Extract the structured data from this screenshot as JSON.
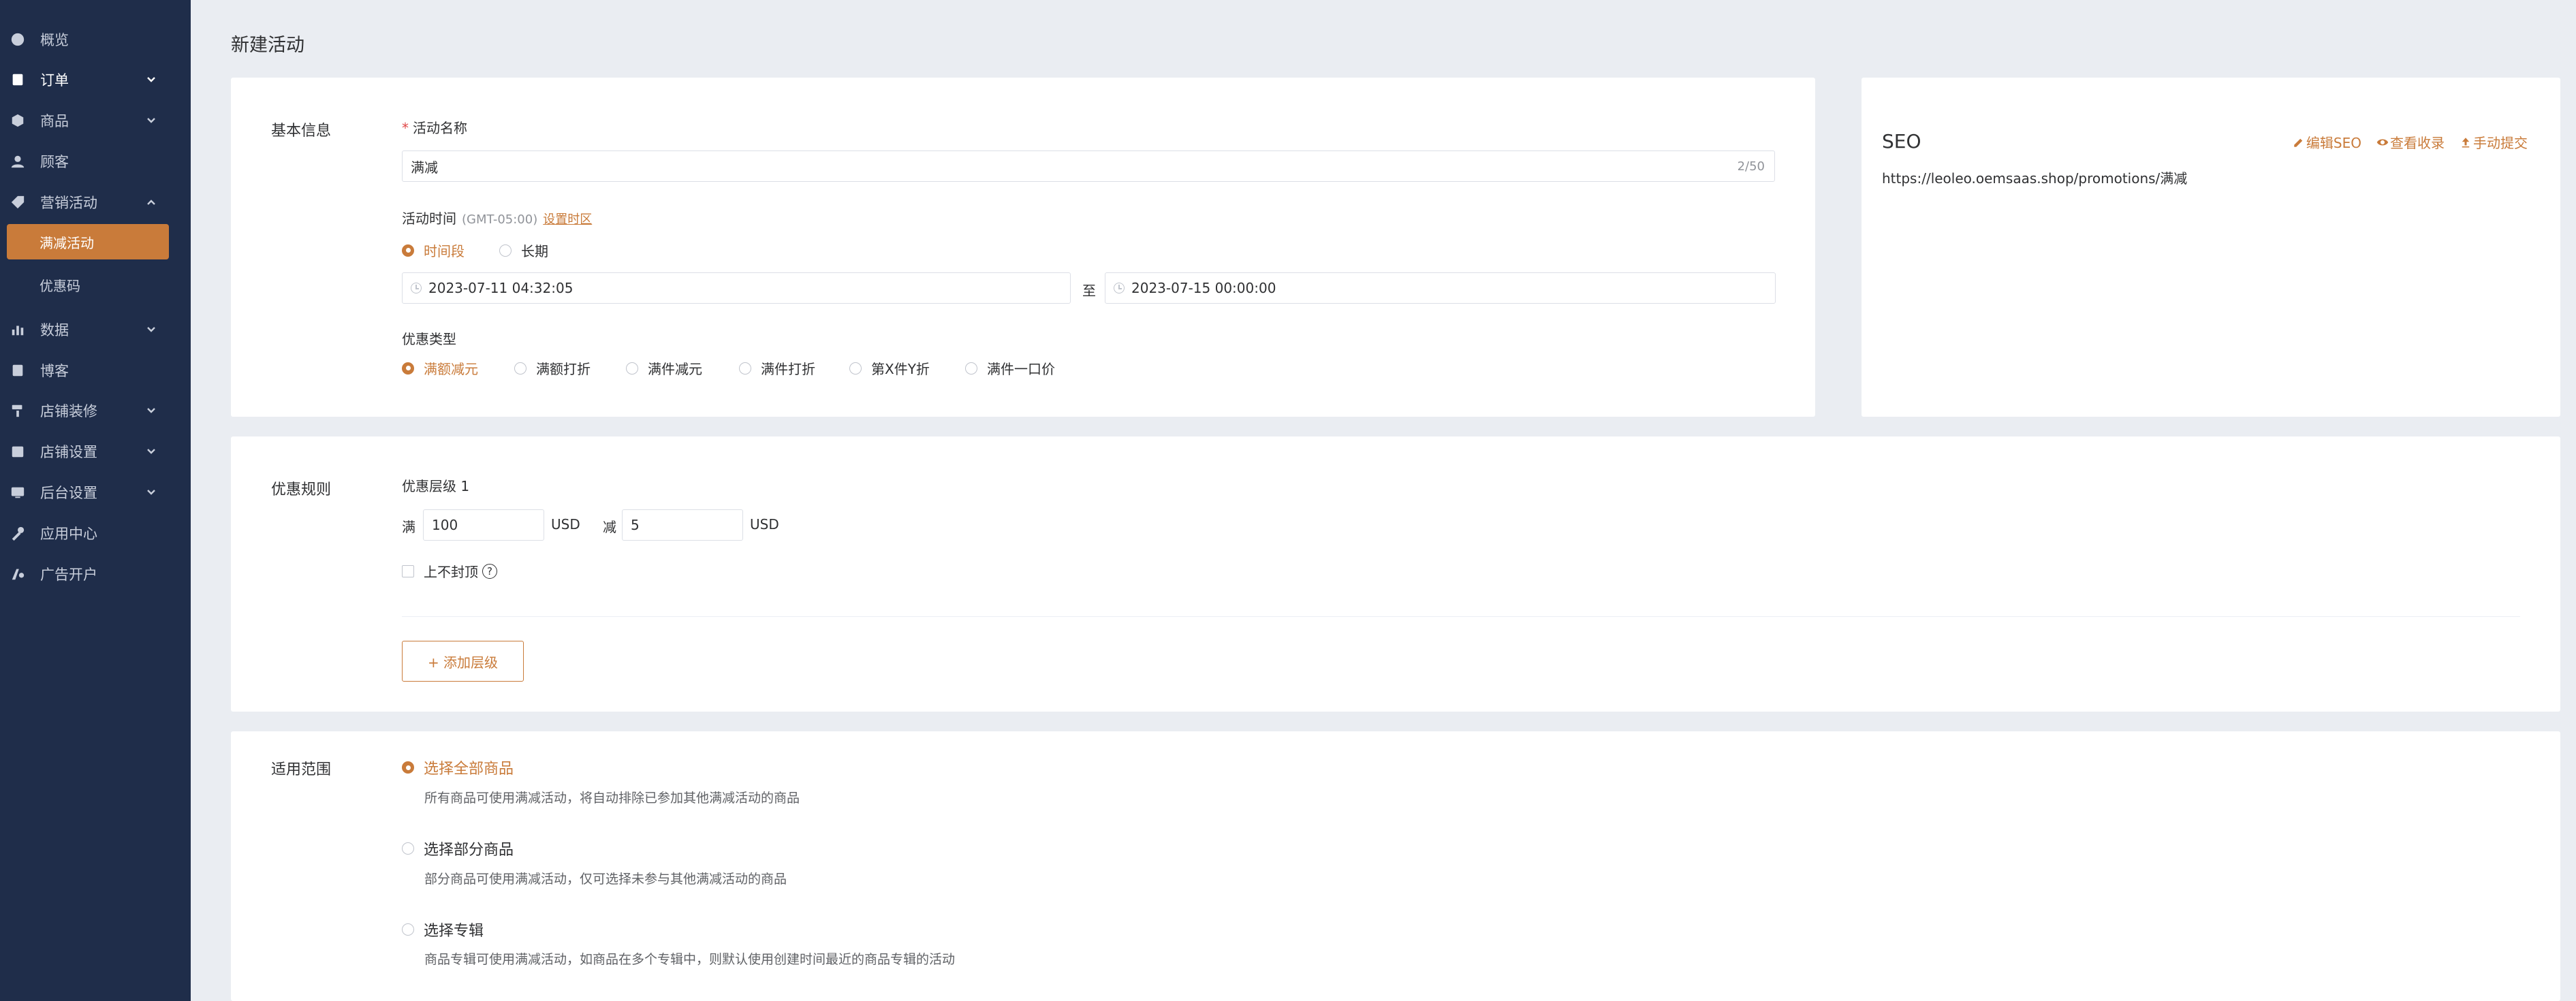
{
  "sidebar": {
    "items": [
      {
        "label": "概览",
        "icon": "dashboard-icon"
      },
      {
        "label": "订单",
        "icon": "order-icon"
      },
      {
        "label": "商品",
        "icon": "product-icon"
      },
      {
        "label": "顾客",
        "icon": "customer-icon"
      },
      {
        "label": "营销活动",
        "icon": "marketing-icon"
      },
      {
        "label": "数据",
        "icon": "data-icon"
      },
      {
        "label": "博客",
        "icon": "blog-icon"
      },
      {
        "label": "店铺装修",
        "icon": "decoration-icon"
      },
      {
        "label": "店铺设置",
        "icon": "store-settings-icon"
      },
      {
        "label": "后台设置",
        "icon": "admin-settings-icon"
      },
      {
        "label": "应用中心",
        "icon": "app-center-icon"
      },
      {
        "label": "广告开户",
        "icon": "ads-icon"
      }
    ],
    "marketing_sub": {
      "active": "满减活动",
      "coupon": "优惠码"
    }
  },
  "page": {
    "title": "新建活动"
  },
  "basic": {
    "section_label": "基本信息",
    "name_label": "活动名称",
    "name_required_mark": "*",
    "name_value": "满减",
    "name_counter": "2/50",
    "time_label": "活动时间",
    "time_zone": "(GMT-05:00)",
    "time_zone_link": "设置时区",
    "time_mode_period": "时间段",
    "time_mode_long": "长期",
    "start_time": "2023-07-11 04:32:05",
    "to_text": "至",
    "end_time": "2023-07-15 00:00:00",
    "discount_type_label": "优惠类型",
    "discount_types": [
      "满额减元",
      "满额打折",
      "满件减元",
      "满件打折",
      "第X件Y折",
      "满件一口价"
    ]
  },
  "seo": {
    "title": "SEO",
    "edit": "编辑SEO",
    "view": "查看收录",
    "submit": "手动提交",
    "url": "https://leoleo.oemsaas.shop/promotions/满减"
  },
  "rules": {
    "section_label": "优惠规则",
    "tier_label": "优惠层级 1",
    "full_text": "满",
    "threshold": "100",
    "currency1": "USD",
    "minus_text": "减",
    "amount": "5",
    "currency2": "USD",
    "no_cap_label": "上不封顶",
    "help_mark": "?",
    "add_tier": "+ 添加层级"
  },
  "scope": {
    "section_label": "适用范围",
    "options": [
      {
        "title": "选择全部商品",
        "desc": "所有商品可使用满减活动，将自动排除已参加其他满减活动的商品"
      },
      {
        "title": "选择部分商品",
        "desc": "部分商品可使用满减活动，仅可选择未参与其他满减活动的商品"
      },
      {
        "title": "选择专辑",
        "desc": "商品专辑可使用满减活动，如商品在多个专辑中，则默认使用创建时间最近的商品专辑的活动"
      }
    ]
  },
  "colors": {
    "accent": "#c97b3a",
    "sidebar": "#1f2d4a",
    "background": "#eaedf2"
  }
}
